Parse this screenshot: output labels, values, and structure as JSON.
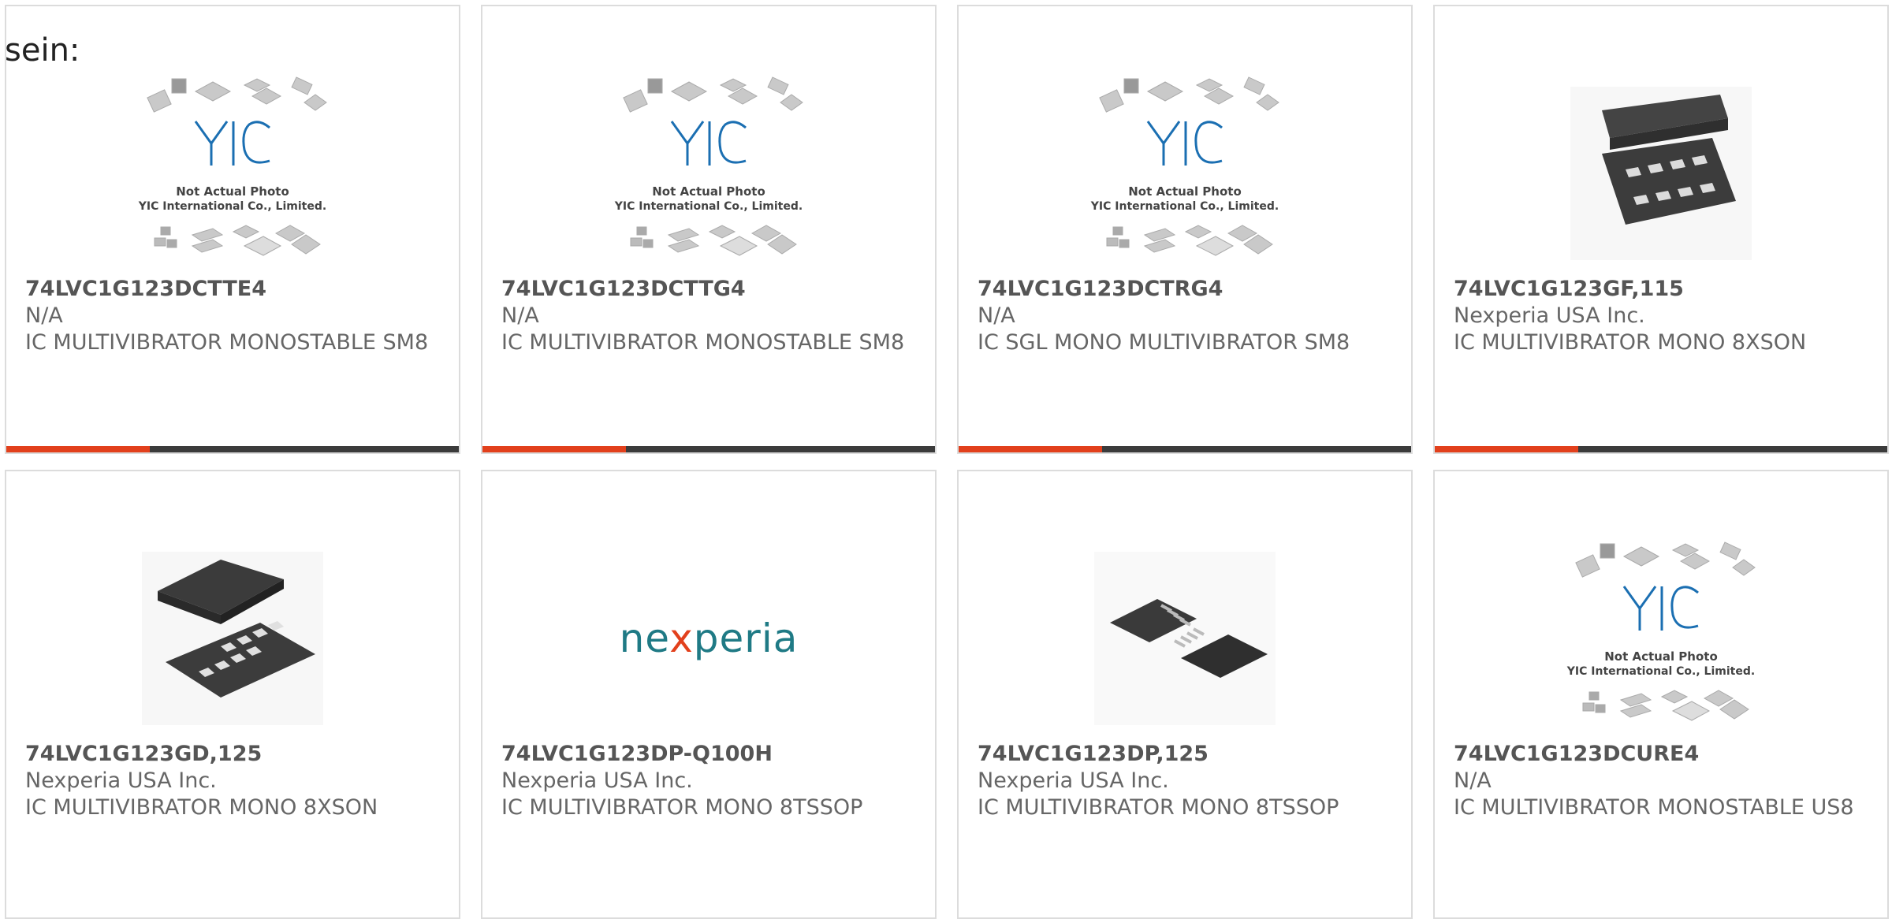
{
  "intro_text": "sein:",
  "placeholder": {
    "line1": "Not Actual Photo",
    "line2": "YIC International Co., Limited.",
    "logo_text": "YIC"
  },
  "brand_logo": {
    "pre": "ne",
    "x": "x",
    "post": "peria"
  },
  "colors": {
    "accent": "#e2401c",
    "bar": "#3b3b3b",
    "border": "#dcdcdc",
    "text": "#666666"
  },
  "products": [
    {
      "part": "74LVC1G123DCTTE4",
      "maker": "N/A",
      "desc": "IC MULTIVIBRATOR MONOSTABLE SM8",
      "image": "yic-placeholder"
    },
    {
      "part": "74LVC1G123DCTTG4",
      "maker": "N/A",
      "desc": "IC MULTIVIBRATOR MONOSTABLE SM8",
      "image": "yic-placeholder"
    },
    {
      "part": "74LVC1G123DCTRG4",
      "maker": "N/A",
      "desc": "IC SGL MONO MULTIVIBRATOR SM8",
      "image": "yic-placeholder"
    },
    {
      "part": "74LVC1G123GF,115",
      "maker": "Nexperia USA Inc.",
      "desc": "IC MULTIVIBRATOR MONO 8XSON",
      "image": "xson-package"
    },
    {
      "part": "74LVC1G123GD,125",
      "maker": "Nexperia USA Inc.",
      "desc": "IC MULTIVIBRATOR MONO 8XSON",
      "image": "xson-package"
    },
    {
      "part": "74LVC1G123DP-Q100H",
      "maker": "Nexperia USA Inc.",
      "desc": "IC MULTIVIBRATOR MONO 8TSSOP",
      "image": "nexperia-logo"
    },
    {
      "part": "74LVC1G123DP,125",
      "maker": "Nexperia USA Inc.",
      "desc": "IC MULTIVIBRATOR MONO 8TSSOP",
      "image": "tssop-package"
    },
    {
      "part": "74LVC1G123DCURE4",
      "maker": "N/A",
      "desc": "IC MULTIVIBRATOR MONOSTABLE US8",
      "image": "yic-placeholder"
    }
  ]
}
